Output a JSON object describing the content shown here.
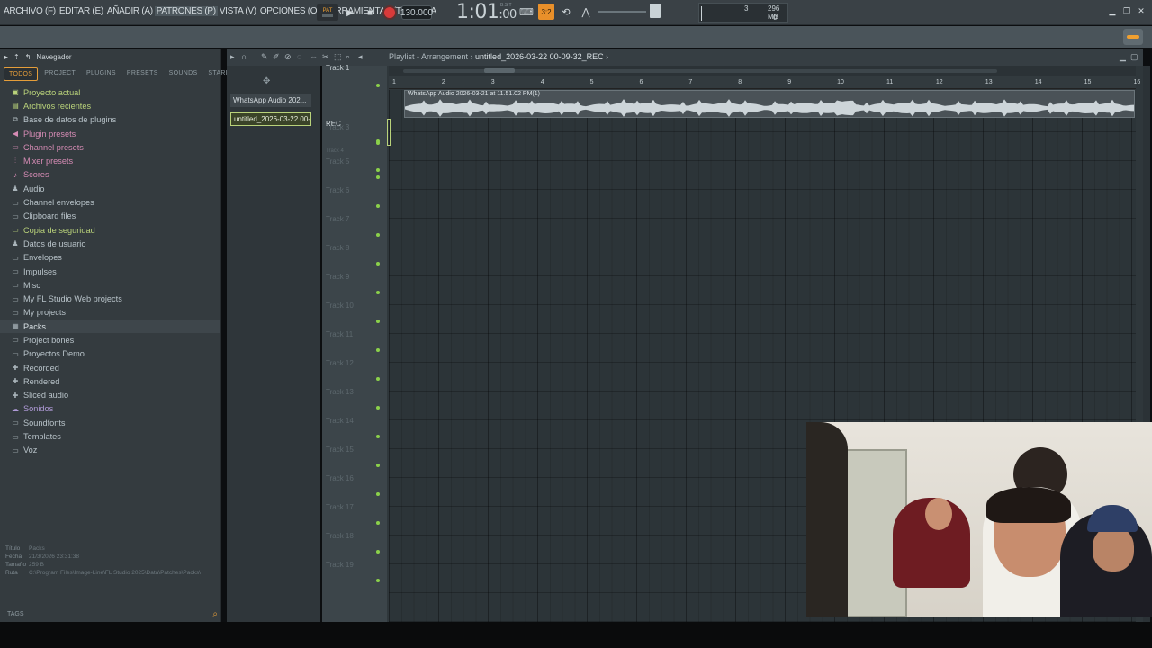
{
  "menu": [
    "ARCHIVO (F)",
    "EDITAR (E)",
    "AÑADIR (A)",
    "PATRONES (P)",
    "VISTA (V)",
    "OPCIONES (O)",
    "HERRAMIENTAS (T)",
    "AYUDA"
  ],
  "transport": {
    "pat_label": "PAT",
    "tempo": "130.000",
    "time": "1:01",
    "time_sub": ":00",
    "time_unit": "B:S:T",
    "snap": "3:2"
  },
  "cpu": {
    "value1": "3",
    "memory": "296 MB",
    "value2": "0"
  },
  "browser": {
    "title": "Navegador",
    "tabs": [
      "TODOS",
      "PROJECT",
      "PLUGINS",
      "PRESETS",
      "SOUNDS",
      "STARRED"
    ],
    "items": [
      {
        "label": "Proyecto actual",
        "icon": "▣",
        "cls": "green"
      },
      {
        "label": "Archivos recientes",
        "icon": "▤",
        "cls": "green"
      },
      {
        "label": "Base de datos de plugins",
        "icon": "⧉",
        "cls": ""
      },
      {
        "label": "Plugin presets",
        "icon": "◀",
        "cls": "pink"
      },
      {
        "label": "Channel presets",
        "icon": "▭",
        "cls": "pink"
      },
      {
        "label": "Mixer presets",
        "icon": "⫶",
        "cls": "pink"
      },
      {
        "label": "Scores",
        "icon": "♪",
        "cls": "pink"
      },
      {
        "label": "Audio",
        "icon": "♟",
        "cls": ""
      },
      {
        "label": "Channel envelopes",
        "icon": "▭",
        "cls": ""
      },
      {
        "label": "Clipboard files",
        "icon": "▭",
        "cls": ""
      },
      {
        "label": "Copia de seguridad",
        "icon": "▭",
        "cls": "green"
      },
      {
        "label": "Datos de usuario",
        "icon": "♟",
        "cls": ""
      },
      {
        "label": "Envelopes",
        "icon": "▭",
        "cls": ""
      },
      {
        "label": "Impulses",
        "icon": "▭",
        "cls": ""
      },
      {
        "label": "Misc",
        "icon": "▭",
        "cls": ""
      },
      {
        "label": "My FL Studio Web projects",
        "icon": "▭",
        "cls": ""
      },
      {
        "label": "My projects",
        "icon": "▭",
        "cls": ""
      },
      {
        "label": "Packs",
        "icon": "▦",
        "cls": "hl"
      },
      {
        "label": "Project bones",
        "icon": "▭",
        "cls": ""
      },
      {
        "label": "Proyectos Demo",
        "icon": "▭",
        "cls": ""
      },
      {
        "label": "Recorded",
        "icon": "✚",
        "cls": ""
      },
      {
        "label": "Rendered",
        "icon": "✚",
        "cls": ""
      },
      {
        "label": "Sliced audio",
        "icon": "✚",
        "cls": ""
      },
      {
        "label": "Sonidos",
        "icon": "☁",
        "cls": "violet"
      },
      {
        "label": "Soundfonts",
        "icon": "▭",
        "cls": ""
      },
      {
        "label": "Templates",
        "icon": "▭",
        "cls": ""
      },
      {
        "label": "Voz",
        "icon": "▭",
        "cls": ""
      }
    ],
    "info": {
      "title_k": "Título",
      "title_v": "Packs",
      "date_k": "Fecha",
      "date_v": "21/3/2026 23:31:38",
      "size_k": "Tamaño",
      "size_v": "259 B",
      "path_k": "Ruta",
      "path_v": "C:\\Program Files\\Image-Line\\FL Studio 2025\\Data\\Patches\\Packs\\"
    },
    "tags": "TAGS"
  },
  "picker": {
    "clips": [
      "WhatsApp Audio 202...",
      "untitled_2026-03-22 00-..."
    ]
  },
  "playlist": {
    "title_prefix": "Playlist - Arrangement",
    "title_file": "untitled_2026-03-22 00-09-32_REC",
    "bars": [
      "1",
      "2",
      "3",
      "4",
      "5",
      "6",
      "7",
      "8",
      "9",
      "10",
      "11",
      "12",
      "13",
      "14",
      "15",
      "16"
    ],
    "clip_label": "WhatsApp Audio 2026-03-21 at 11.51.02 PM(1)",
    "tracks": [
      "Track 1",
      "REC",
      "Track 3",
      "Track 4",
      "Track 5",
      "Track 6",
      "Track 7",
      "Track 8",
      "Track 9",
      "Track 10",
      "Track 11",
      "Track 12",
      "Track 13",
      "Track 14",
      "Track 15",
      "Track 16",
      "Track 17",
      "Track 18",
      "Track 19"
    ]
  }
}
